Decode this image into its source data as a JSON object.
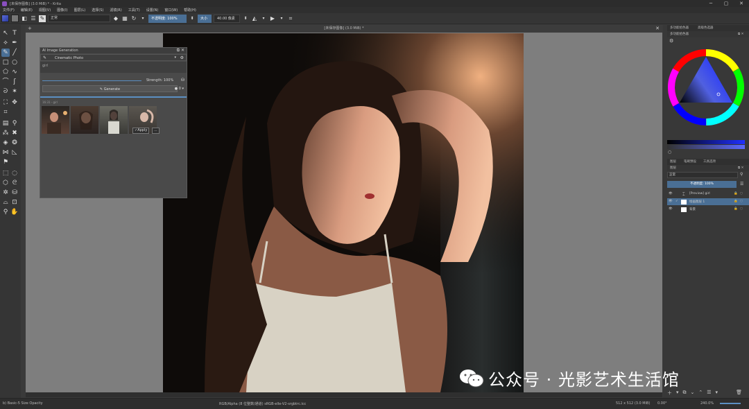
{
  "window": {
    "title": "[未保存图像] (3.0 MiB) * - Krita",
    "min": "─",
    "max": "▢",
    "close": "✕"
  },
  "menu": [
    "文件(F)",
    "编辑(E)",
    "视图(V)",
    "图像(I)",
    "图层(L)",
    "选择(S)",
    "滤镜(R)",
    "工具(T)",
    "设置(N)",
    "窗口(W)",
    "帮助(H)"
  ],
  "toolbar": {
    "blend_mode": "正常",
    "opacity_label": "不透明度: 100%",
    "size_label": "大小",
    "size_value": "40.00 像素"
  },
  "document": {
    "tab_title": "[未保存图像] (3.0 MiB) *",
    "plus": "+",
    "close": "✕"
  },
  "ai_panel": {
    "title": "AI Image Generation",
    "style": "Cinematic Photo",
    "prompt": "girl",
    "strength_label": "Strength: 100%",
    "generate_label": "Generate",
    "history_label": "16:31 - girl",
    "apply_label": "Apply",
    "more_label": "...",
    "queue_count": "0"
  },
  "right_dock": {
    "tabs_top": [
      "多功能拾色器",
      "高级色选器"
    ],
    "color_picker_title": "多功能拾色器",
    "layer_tabs": [
      "图层",
      "笔刷预设",
      "工具选项"
    ],
    "layers_title": "图层",
    "blend_mode": "正常",
    "opacity": "不透明度: 100%",
    "layers": [
      {
        "name": "[Preview] girl",
        "selected": false
      },
      {
        "name": "绘画图层 1",
        "selected": true
      },
      {
        "name": "背景",
        "selected": false
      }
    ]
  },
  "status": {
    "brush": "b) Basic-5 Size Opacity",
    "color_space": "RGB/Alpha (8 位整数/通道)  sRGB-elle-V2-srgbtrc.icc",
    "size": "512 x 512 (3.0 MiB)",
    "rotation": "0.00°",
    "zoom": "240.0%"
  },
  "watermark": {
    "text": "公众号 · 光影艺术生活馆"
  },
  "colors": {
    "accent": "#4a6f95",
    "panel": "#4a4a4a",
    "canvas_bg": "#7e7e7e"
  }
}
